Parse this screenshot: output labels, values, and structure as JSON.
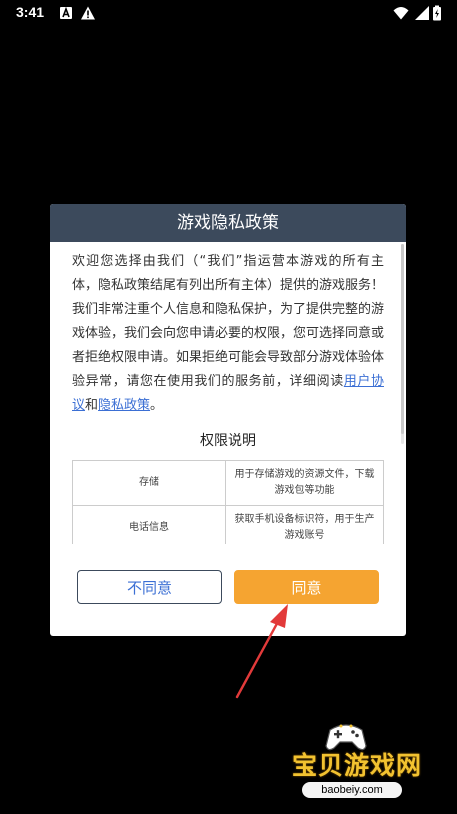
{
  "status_bar": {
    "time": "3:41"
  },
  "dialog": {
    "title": "游戏隐私政策",
    "intro_part1": "欢迎您选择由我们（“我们”指运营本游戏的所有主体，隐私政策结尾有列出所有主体）提供的游戏服务！我们非常注重个人信息和隐私保护，为了提供完整的游戏体验，我们会向您申请必要的权限，您可选择同意或者拒绝权限申请。如果拒绝可能会导致部分游戏体验体验异常，请您在使用我们的服务前，详细阅读",
    "link_user_agreement": "用户协议",
    "intro_and": "和",
    "link_privacy_policy": "隐私政策",
    "intro_end": "。",
    "permissions_title": "权限说明",
    "permissions": [
      {
        "name": "存储",
        "desc": "用于存储游戏的资源文件，下载游戏包等功能"
      },
      {
        "name": "电话信息",
        "desc": "获取手机设备标识符，用于生产游戏账号"
      },
      {
        "name": "",
        "desc": ""
      }
    ],
    "disagree_label": "不同意",
    "agree_label": "同意"
  },
  "colors": {
    "header_bg": "#3c4a5c",
    "agree_bg": "#f5a431",
    "link": "#3b6fd4",
    "arrow": "#e23a3a"
  },
  "watermark": {
    "title": "宝贝游戏网",
    "url": "baobeiy.com"
  }
}
